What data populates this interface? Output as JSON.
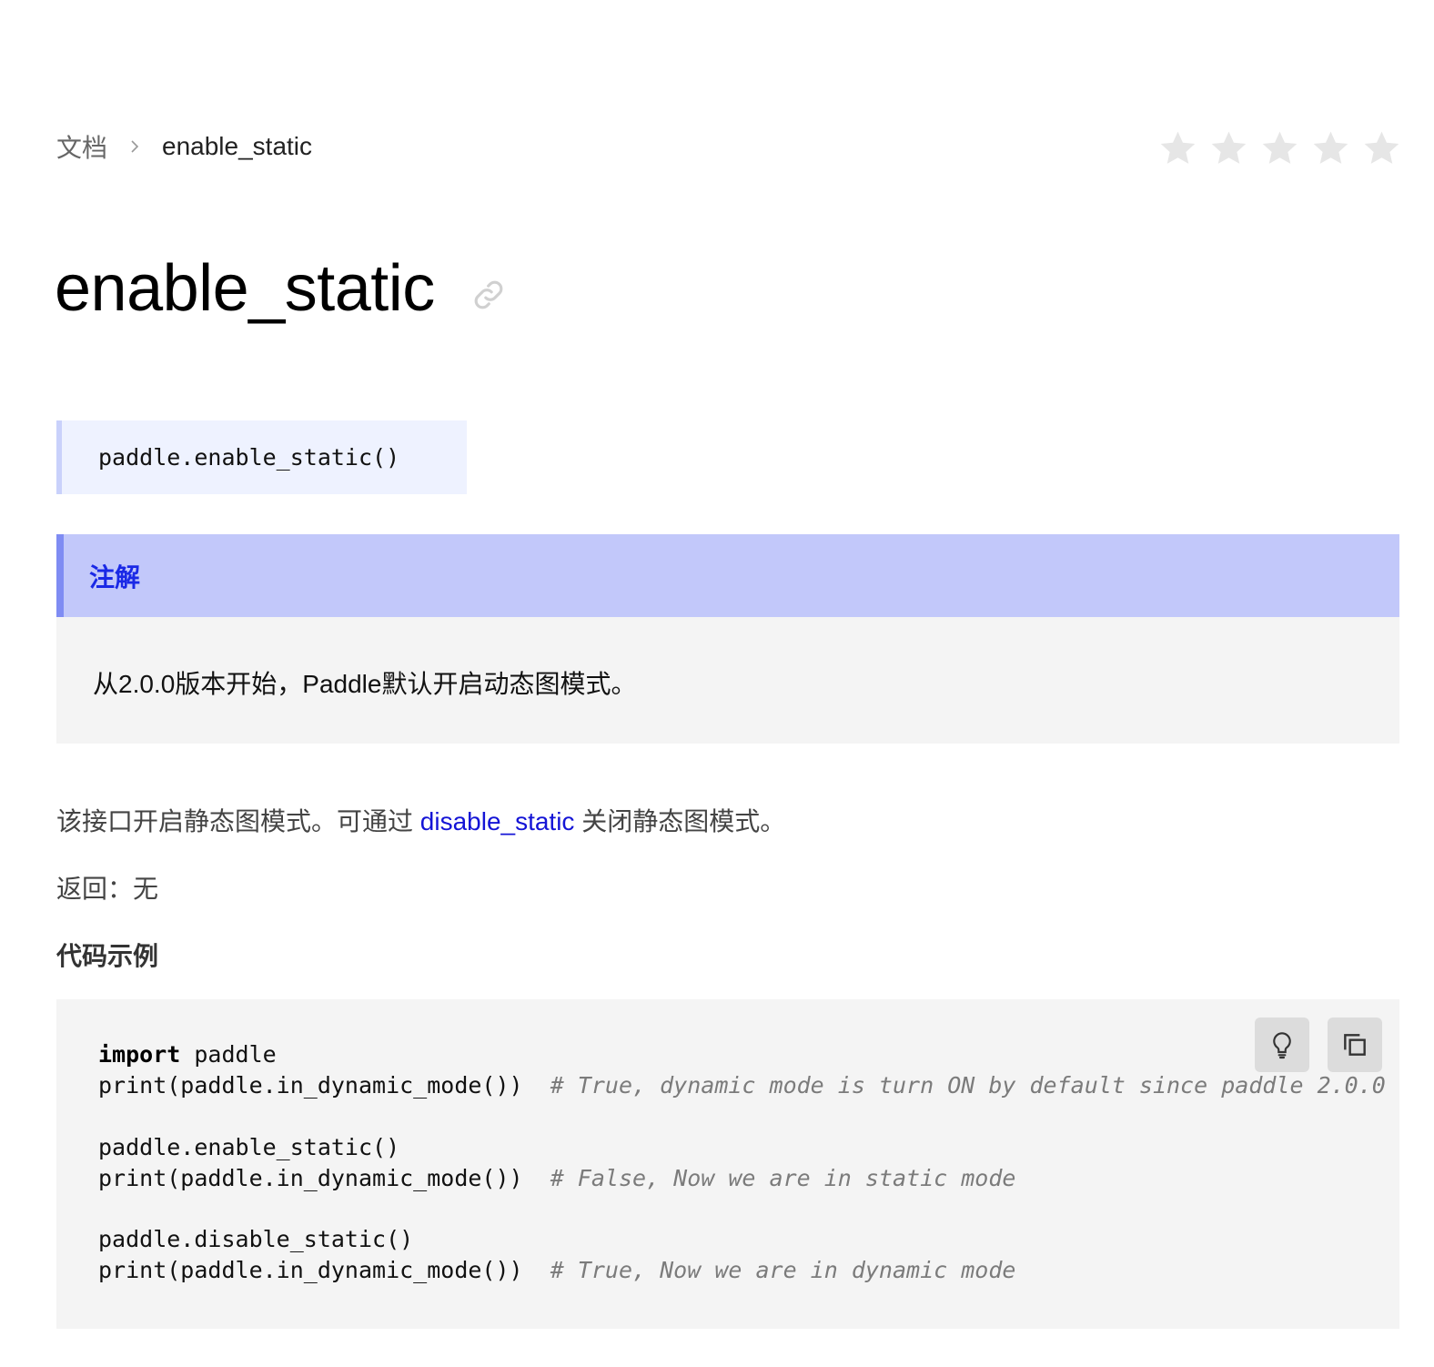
{
  "breadcrumb": {
    "home": "文档",
    "current": "enable_static"
  },
  "rating": {
    "value": 0,
    "max": 5,
    "icon": "star-icon",
    "color": "#e6e6e6"
  },
  "title": "enable_static",
  "signature": "paddle.enable_static()",
  "note": {
    "label": "注解",
    "text": "从2.0.0版本开始，Paddle默认开启动态图模式。"
  },
  "description": {
    "before": "该接口开启静态图模式。可通过 ",
    "link": "disable_static",
    "after": " 关闭静态图模式。"
  },
  "returns": "返回：无",
  "example_heading": "代码示例",
  "code": {
    "line1_kw": "import",
    "line1_rest": " paddle",
    "line2_code": "print(paddle.in_dynamic_mode())  ",
    "line2_comment": "# True, dynamic mode is turn ON by default since paddle 2.0.0",
    "line3_code": "paddle.enable_static()",
    "line4_code": "print(paddle.in_dynamic_mode())  ",
    "line4_comment": "# False, Now we are in static mode",
    "line5_code": "paddle.disable_static()",
    "line6_code": "print(paddle.in_dynamic_mode())  ",
    "line6_comment": "# True, Now we are in dynamic mode"
  },
  "code_buttons": {
    "hint_icon": "lightbulb-icon",
    "copy_icon": "copy-icon"
  },
  "colors": {
    "note_header_bg": "#c2c8fa",
    "note_accent": "#7f8cf3",
    "note_label": "#1a29e6",
    "signature_bg": "#eef2ff",
    "link": "#1414d6",
    "code_bg": "#f4f4f4"
  }
}
